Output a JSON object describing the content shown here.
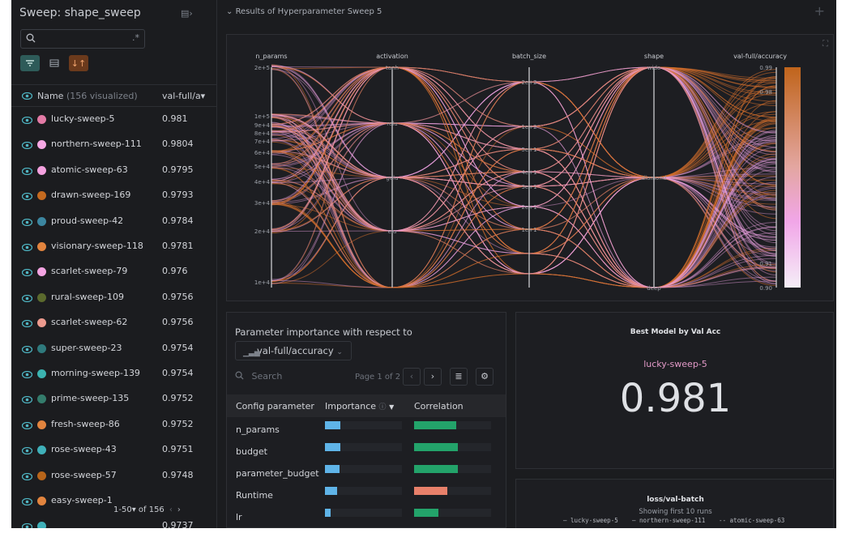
{
  "sidebar": {
    "title": "Sweep: shape_sweep",
    "search_placeholder": "",
    "header": {
      "name": "Name",
      "count": "(156 visualized)",
      "value": "val-full/a▾"
    },
    "runs": [
      {
        "name": "lucky-sweep-5",
        "value": "0.981",
        "color": "#e37ba6"
      },
      {
        "name": "northern-sweep-111",
        "value": "0.9804",
        "color": "#f7a8e4"
      },
      {
        "name": "atomic-sweep-63",
        "value": "0.9795",
        "color": "#f4a1df"
      },
      {
        "name": "drawn-sweep-169",
        "value": "0.9793",
        "color": "#c46a1f"
      },
      {
        "name": "proud-sweep-42",
        "value": "0.9784",
        "color": "#3c86a0"
      },
      {
        "name": "visionary-sweep-118",
        "value": "0.9781",
        "color": "#e2843e"
      },
      {
        "name": "scarlet-sweep-79",
        "value": "0.976",
        "color": "#f3a3e1"
      },
      {
        "name": "rural-sweep-109",
        "value": "0.9756",
        "color": "#5b6a2d"
      },
      {
        "name": "scarlet-sweep-62",
        "value": "0.9756",
        "color": "#ec9a8e"
      },
      {
        "name": "super-sweep-23",
        "value": "0.9754",
        "color": "#2f7a7d"
      },
      {
        "name": "morning-sweep-139",
        "value": "0.9754",
        "color": "#3bb3b0"
      },
      {
        "name": "prime-sweep-135",
        "value": "0.9752",
        "color": "#347c6c"
      },
      {
        "name": "fresh-sweep-86",
        "value": "0.9752",
        "color": "#e2843e"
      },
      {
        "name": "rose-sweep-43",
        "value": "0.9751",
        "color": "#3fb0b9"
      },
      {
        "name": "rose-sweep-57",
        "value": "0.9748",
        "color": "#b8651a"
      },
      {
        "name": "easy-sweep-1",
        "value": "",
        "color": "#e2843e"
      },
      {
        "name": "",
        "value": "0.9737",
        "color": "#3fb0b9"
      }
    ],
    "pager": "1-50▾ of 156"
  },
  "section": {
    "title": "Results of Hyperparameter Sweep   5"
  },
  "parallel_coords": {
    "axes": [
      {
        "label": "n_params",
        "ticks": [
          "2e+5",
          "1e+5",
          "9e+4",
          "8e+4",
          "7e+4",
          "6e+4",
          "5e+4",
          "4e+4",
          "3e+4",
          "2e+4",
          "1e+4"
        ]
      },
      {
        "label": "activation",
        "ticks": [
          "tanh",
          "relu",
          "gelu",
          "elu"
        ]
      },
      {
        "label": "batch_size",
        "ticks": [
          "2e+2",
          "1e+2",
          "5e+1",
          "4e+1",
          "3e+1",
          "2e+1",
          "1e+1"
        ]
      },
      {
        "label": "shape",
        "ticks": [
          "wide",
          "diamond",
          "deep"
        ]
      },
      {
        "label": "val-full/accuracy",
        "ticks": [
          "0.99",
          "0.98",
          "0.91",
          "0.90"
        ]
      }
    ]
  },
  "importance": {
    "title": "Parameter importance with respect to",
    "metric": "val-full/accuracy",
    "search_placeholder": "Search",
    "page": "Page 1 of 2",
    "headers": {
      "param": "Config parameter",
      "importance": "Importance",
      "correlation": "Correlation"
    },
    "rows": [
      {
        "param": "n_params",
        "importance": 0.2,
        "correlation": 0.55,
        "corr_color": "#23a36a"
      },
      {
        "param": "budget",
        "importance": 0.2,
        "correlation": 0.57,
        "corr_color": "#23a36a"
      },
      {
        "param": "parameter_budget",
        "importance": 0.19,
        "correlation": 0.57,
        "corr_color": "#23a36a"
      },
      {
        "param": "Runtime",
        "importance": 0.16,
        "correlation": 0.43,
        "corr_color": "#e8806a"
      },
      {
        "param": "lr",
        "importance": 0.07,
        "correlation": 0.32,
        "corr_color": "#23a36a"
      }
    ]
  },
  "best_model": {
    "title": "Best Model by Val Acc",
    "run": "lucky-sweep-5",
    "value": "0.981"
  },
  "loss_panel": {
    "title": "loss/val-batch",
    "subtitle": "Showing first 10 runs",
    "legend": [
      "lucky-sweep-5",
      "northern-sweep-111",
      "atomic-sweep-63"
    ]
  },
  "colors": {
    "bg": "#1b1c1f",
    "panel": "#1d1e22",
    "accent": "#e39ac8",
    "orange": "#e0772b",
    "pink": "#f0a6e6"
  }
}
